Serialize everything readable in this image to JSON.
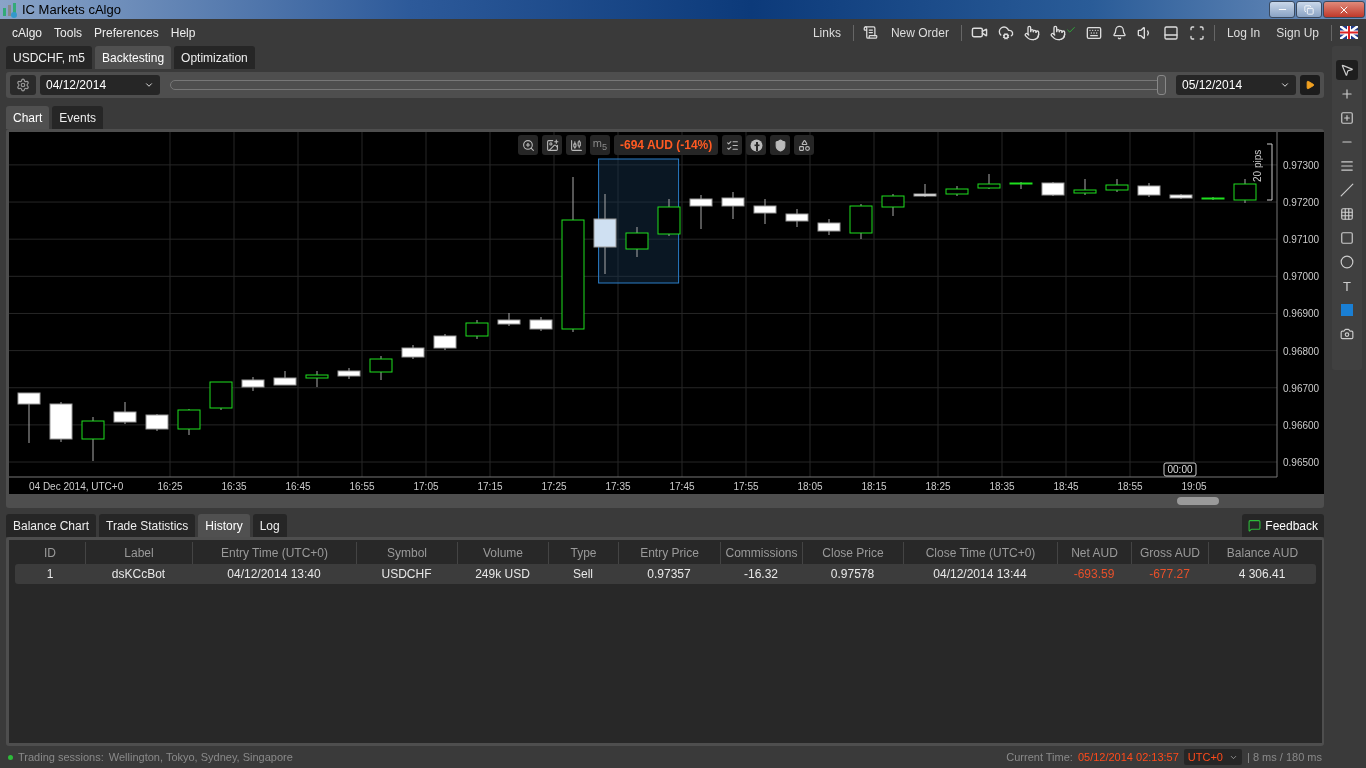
{
  "window": {
    "title": "IC Markets cAlgo"
  },
  "menu": [
    "cAlgo",
    "Tools",
    "Preferences",
    "Help"
  ],
  "header": {
    "links": "Links",
    "new_order": "New Order",
    "log_in": "Log In",
    "sign_up": "Sign Up"
  },
  "top_tabs": [
    {
      "label": "USDCHF, m5",
      "selected": false
    },
    {
      "label": "Backtesting",
      "selected": true
    },
    {
      "label": "Optimization",
      "selected": false
    }
  ],
  "backtest": {
    "start_date": "04/12/2014",
    "end_date": "05/12/2014",
    "range": {
      "level": 1
    }
  },
  "chart_tabs": [
    {
      "label": "Chart",
      "selected": true
    },
    {
      "label": "Events",
      "selected": false
    }
  ],
  "chart": {
    "pnl": "-694 AUD (-14%)",
    "timeframe": "m$_{5}$",
    "date_label": "04 Dec 2014, UTC+0",
    "cursor_time": "00:00",
    "range_label": "20 pips",
    "price_labels": [
      "0.97300",
      "0.97200",
      "0.97100",
      "0.97000",
      "0.96900",
      "0.96800",
      "0.96700",
      "0.96600",
      "0.96500"
    ],
    "time_labels": [
      "16:25",
      "16:35",
      "16:45",
      "16:55",
      "17:05",
      "17:15",
      "17:25",
      "17:35",
      "17:45",
      "17:55",
      "18:05",
      "18:15",
      "18:25",
      "18:35",
      "18:45",
      "18:55",
      "19:05"
    ]
  },
  "bottom_tabs": [
    {
      "label": "Balance Chart",
      "selected": false
    },
    {
      "label": "Trade Statistics",
      "selected": false
    },
    {
      "label": "History",
      "selected": true
    },
    {
      "label": "Log",
      "selected": false
    }
  ],
  "feedback": "Feedback",
  "table": {
    "columns": [
      "ID",
      "Label",
      "Entry Time (UTC+0)",
      "Symbol",
      "Volume",
      "Type",
      "Entry Price",
      "Commissions",
      "Close Price",
      "Close Time (UTC+0)",
      "Net AUD",
      "Gross AUD",
      "Balance AUD"
    ],
    "rows": [
      {
        "cells": [
          {
            "text": "1"
          },
          {
            "text": "dsKCcBot"
          },
          {
            "text": "04/12/2014 13:40"
          },
          {
            "text": "USDCHF"
          },
          {
            "text": "249k USD"
          },
          {
            "text": "Sell"
          },
          {
            "text": "0.97357"
          },
          {
            "text": "-16.32"
          },
          {
            "text": "0.97578"
          },
          {
            "text": "04/12/2014 13:44"
          },
          {
            "text": "-693.59",
            "color": "#e8502a"
          },
          {
            "text": "-677.27",
            "color": "#e8502a"
          },
          {
            "text": "4 306.41"
          }
        ]
      }
    ]
  },
  "status_bar": {
    "sessions_label": "Trading sessions:",
    "sessions": "Wellington, Tokyo, Sydney, Singapore",
    "time_label": "Current Time:",
    "time": "05/12/2014 02:13:57",
    "timezone": "UTC+0",
    "latency": "| 8 ms / 180 ms"
  },
  "right_tools": [
    {
      "kind": "pointer",
      "selected": true
    },
    {
      "kind": "crosshair",
      "selected": false
    },
    {
      "kind": "measure",
      "selected": false
    },
    {
      "kind": "hline",
      "selected": false
    },
    {
      "kind": "fork",
      "selected": false
    },
    {
      "kind": "diagonal",
      "selected": false
    },
    {
      "kind": "lines",
      "selected": false
    },
    {
      "kind": "rect",
      "selected": false
    },
    {
      "kind": "circle",
      "selected": false
    },
    {
      "kind": "text",
      "label": "T",
      "selected": false
    },
    {
      "kind": "color",
      "color": "#1a7fd4"
    },
    {
      "kind": "camera",
      "selected": false
    }
  ]
}
